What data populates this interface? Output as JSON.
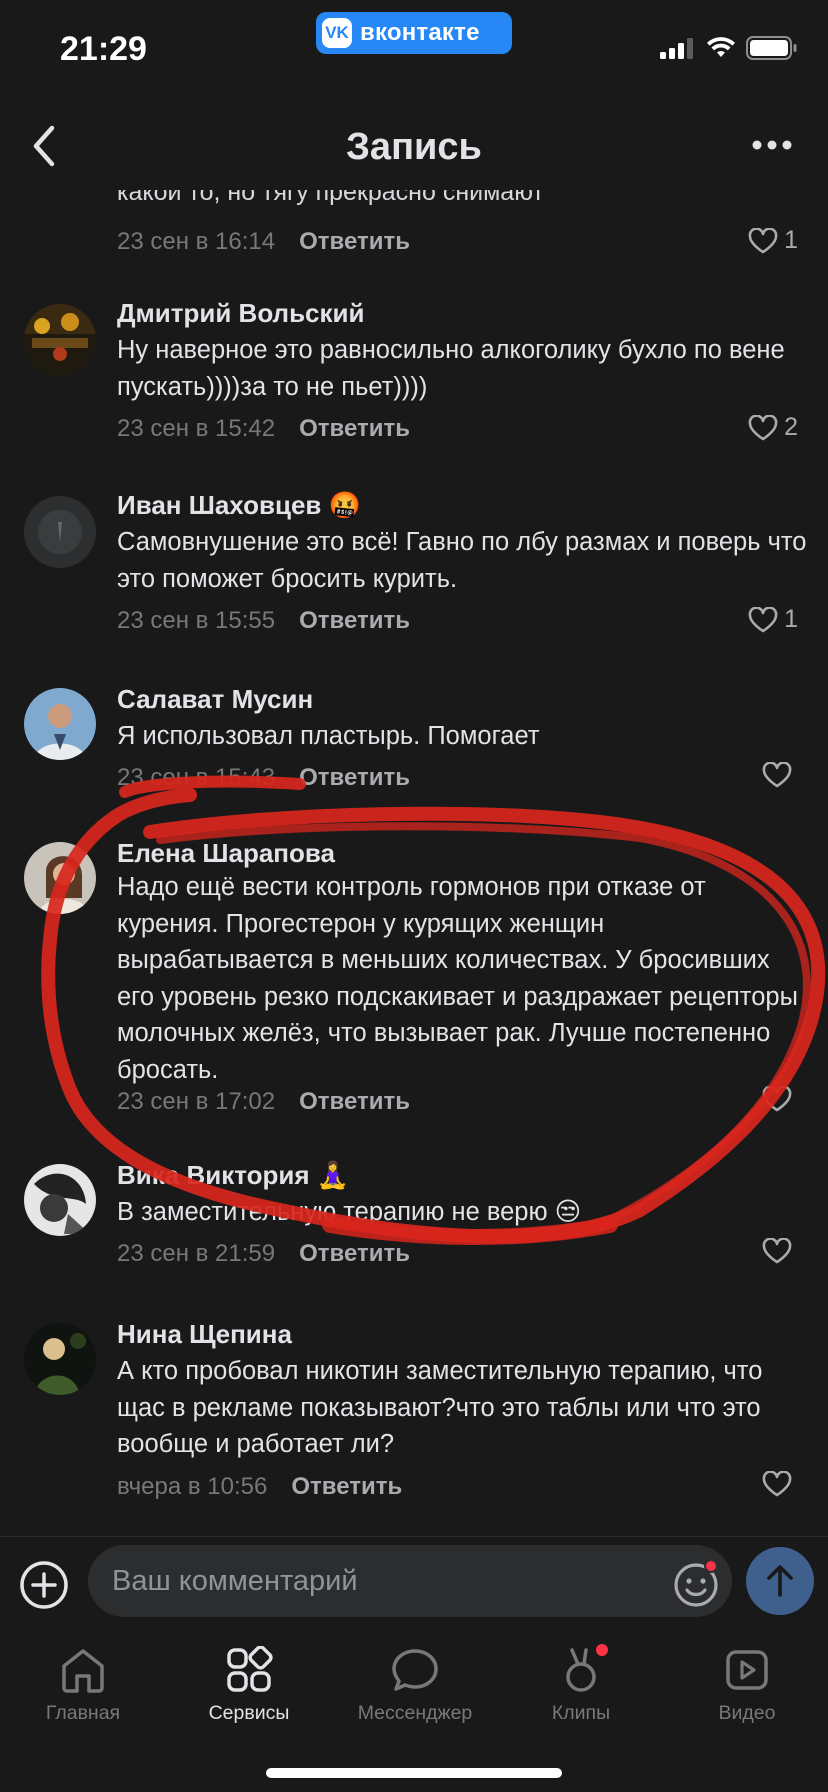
{
  "status_bar": {
    "time": "21:29",
    "vk_label": "вконтакте",
    "vk_logo": "VK"
  },
  "header": {
    "title": "Запись",
    "back_icon": "chevron-left-icon",
    "more_icon": "more-dots-icon"
  },
  "partial_comment": {
    "text": "какой то, но тягу прекрасно снимают",
    "date": "23 сен в 16:14",
    "reply": "Ответить",
    "likes": "1"
  },
  "comments": [
    {
      "name": "Дмитрий Вольский",
      "text": "Ну наверное это равносильно алкоголику бухло по вене пускать))))за то не пьет))))",
      "date": "23 сен в 15:42",
      "reply": "Ответить",
      "likes": "2"
    },
    {
      "name": "Иван Шаховцев",
      "emoji": "🤬",
      "text": "Самовнушение это всё! Гавно по лбу размах и поверь что это поможет бросить курить.",
      "date": "23 сен в 15:55",
      "reply": "Ответить",
      "likes": "1"
    },
    {
      "name": "Салават Мусин",
      "text": "Я использовал пластырь. Помогает",
      "date": "23 сен в 15:43",
      "reply": "Ответить",
      "likes": ""
    },
    {
      "name": "Елена Шарапова",
      "text": "Надо ещё вести контроль гормонов при отказе от курения. Прогестерон у курящих женщин вырабатывается в меньших количествах. У бросивших его уровень резко подскакивает и раздражает рецепторы молочных желёз, что вызывает рак. Лучше постепенно бросать.",
      "date": "23 сен в 17:02",
      "reply": "Ответить",
      "likes": ""
    },
    {
      "name": "Вика Виктория",
      "emoji": "🧘‍♀️",
      "text": "В заместительную терапию не верю 😒",
      "date": "23 сен в 21:59",
      "reply": "Ответить",
      "likes": ""
    },
    {
      "name": "Нина Щепина",
      "text": "А кто пробовал никотин заместительную терапию, что щас в рекламе показывают?что это таблы или что это вообще и работает ли?",
      "date": "вчера в 10:56",
      "reply": "Ответить",
      "likes": ""
    }
  ],
  "composer": {
    "placeholder": "Ваш комментарий"
  },
  "tabs": [
    {
      "label": "Главная",
      "icon": "home-icon"
    },
    {
      "label": "Сервисы",
      "icon": "services-icon"
    },
    {
      "label": "Мессенджер",
      "icon": "messenger-icon"
    },
    {
      "label": "Клипы",
      "icon": "clips-icon"
    },
    {
      "label": "Видео",
      "icon": "video-icon"
    }
  ],
  "colors": {
    "background": "#19191a",
    "text": "#e1e3e6",
    "secondary": "#76787a",
    "accent": "#2787f5",
    "annotation": "#d9261c"
  }
}
